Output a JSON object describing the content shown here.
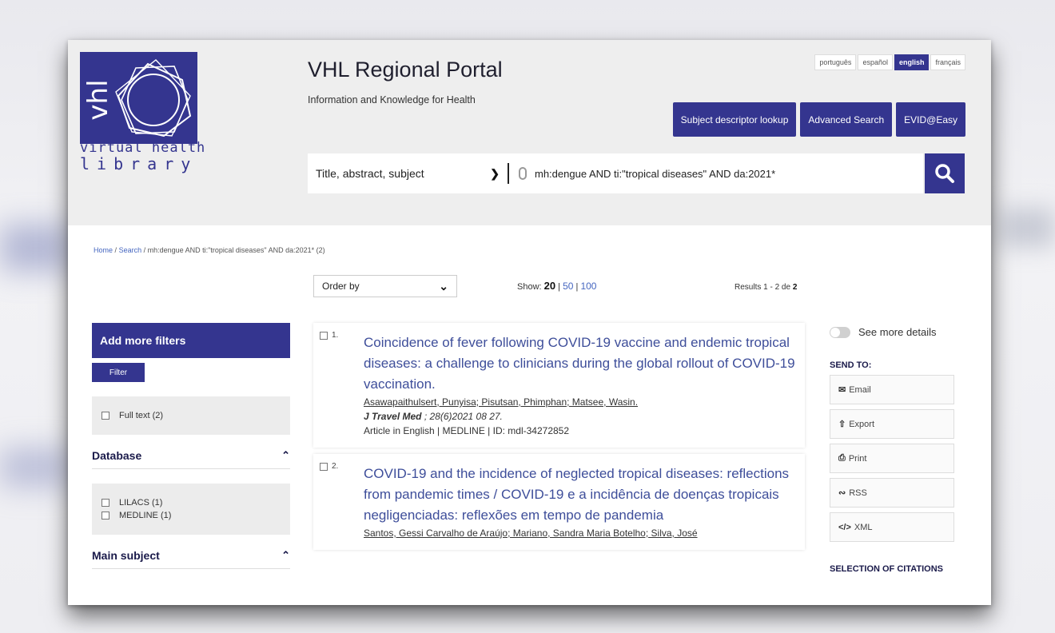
{
  "header": {
    "logo_line1": "virtual health",
    "logo_line2": "library",
    "title": "VHL Regional Portal",
    "subtitle": "Information and Knowledge for Health",
    "languages": [
      "português",
      "español",
      "english",
      "français"
    ],
    "active_language": "english",
    "buttons": [
      "Subject descriptor lookup",
      "Advanced Search",
      "EVID@Easy"
    ]
  },
  "search": {
    "field": "Title, abstract, subject",
    "query": "mh:dengue AND ti:\"tropical diseases\" AND da:2021*"
  },
  "breadcrumb": {
    "home": "Home",
    "sep": "/",
    "search": "Search",
    "current": "mh:dengue AND ti:\"tropical diseases\" AND da:2021* (2)"
  },
  "toolbar": {
    "order_by": "Order by",
    "show_label": "Show:",
    "show_current": "20",
    "show_opt1": "50",
    "show_opt2": "100",
    "results_prefix": "Results 1 - 2 de",
    "results_total": "2"
  },
  "sidebar": {
    "add_filters": "Add more filters",
    "filter_button": "Filter",
    "full_text": "Full text (2)",
    "database_title": "Database",
    "db_items": [
      "LILACS (1)",
      "MEDLINE (1)"
    ],
    "main_subject_title": "Main subject"
  },
  "results": [
    {
      "num": "1.",
      "title": "Coincidence of fever following COVID-19 vaccine and endemic tropical diseases: a challenge to clinicians during the global rollout of COVID-19 vaccination.",
      "authors": "Asawapaithulsert, Punyisa; Pisutsan, Phimphan; Matsee, Wasin.",
      "journal": "J Travel Med",
      "journal_rest": " ; 28(6)2021 08 27.",
      "meta": "Article in English | MEDLINE | ID: mdl-34272852"
    },
    {
      "num": "2.",
      "title": "COVID-19 and the incidence of neglected tropical diseases: reflections from pandemic times / COVID-19 e a incidência de doenças tropicais negligenciadas: reflexões em tempo de pandemia",
      "authors": "Santos, Gessi Carvalho de Araújo; Mariano, Sandra Maria Botelho; Silva, José"
    }
  ],
  "rightcol": {
    "see_more": "See more details",
    "send_to": "SEND TO:",
    "send_items": [
      "Email",
      "Export",
      "Print",
      "RSS",
      "XML"
    ],
    "selection": "SELECTION OF CITATIONS"
  },
  "colors": {
    "brand": "#34358f",
    "link": "#3e4e9a"
  }
}
